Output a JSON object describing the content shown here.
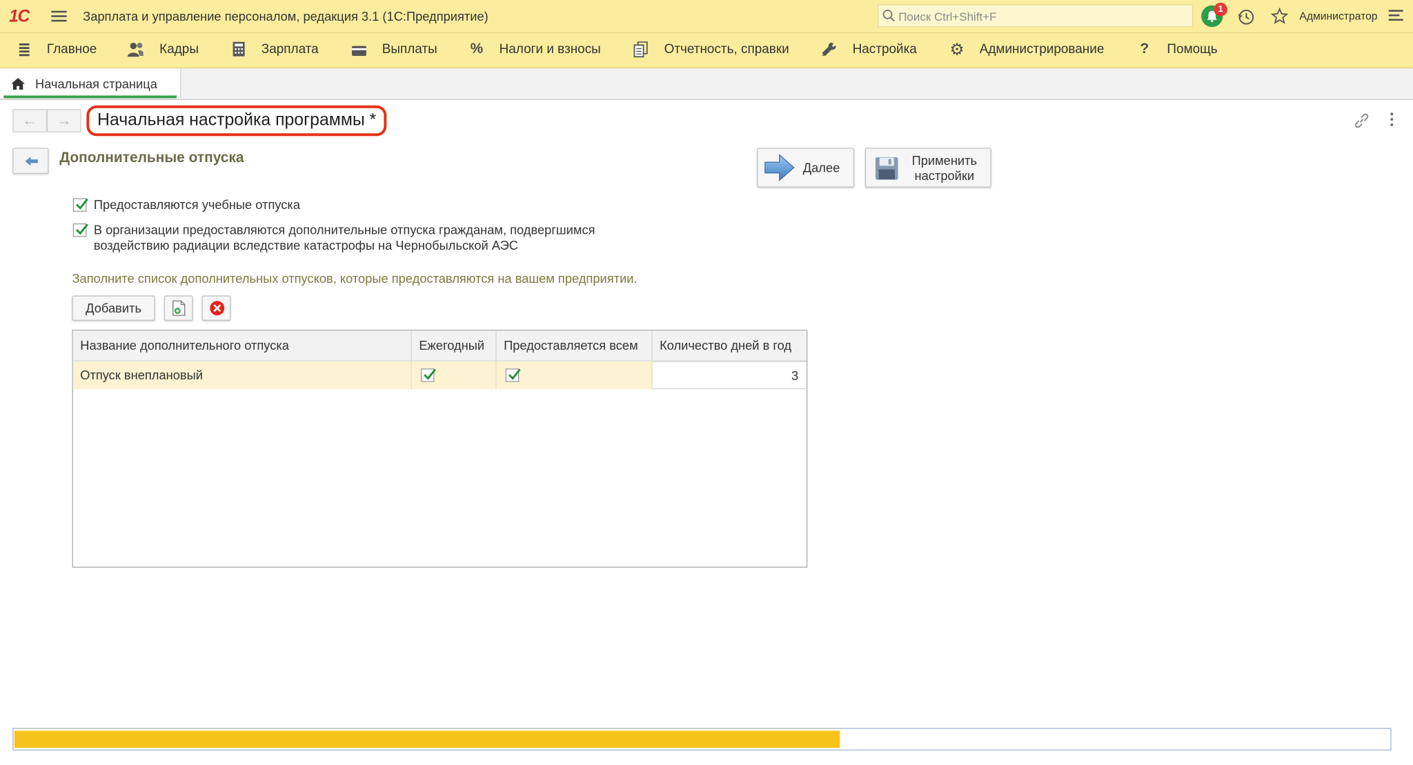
{
  "app": {
    "logo": "1С",
    "title": "Зарплата и управление персоналом, редакция 3.1  (1С:Предприятие)",
    "search_placeholder": "Поиск Ctrl+Shift+F",
    "notifications_count": "1",
    "user": "Администратор"
  },
  "sections": [
    {
      "label": "Главное",
      "icon": "menu-icon"
    },
    {
      "label": "Кадры",
      "icon": "people-icon"
    },
    {
      "label": "Зарплата",
      "icon": "calculator-icon"
    },
    {
      "label": "Выплаты",
      "icon": "wallet-icon"
    },
    {
      "label": "Налоги и взносы",
      "icon": "percent-icon"
    },
    {
      "label": "Отчетность, справки",
      "icon": "documents-icon"
    },
    {
      "label": "Настройка",
      "icon": "wrench-icon"
    },
    {
      "label": "Администрирование",
      "icon": "gear-icon"
    },
    {
      "label": "Помощь",
      "icon": "question-icon"
    }
  ],
  "tabs": {
    "home": "Начальная страница"
  },
  "form": {
    "title": "Начальная настройка программы *",
    "heading": "Дополнительные отпуска",
    "next_label": "Далее",
    "apply_label_line1": "Применить",
    "apply_label_line2": "настройки"
  },
  "options": {
    "study_leave": {
      "label": "Предоставляются учебные отпуска",
      "checked": true
    },
    "chernobyl_leave": {
      "line1": "В организации предоставляются дополнительные отпуска гражданам, подвергшимся",
      "line2": "воздействию радиации вследствие катастрофы на Чернобыльской АЭС",
      "checked": true
    }
  },
  "hint": "Заполните список дополнительных отпусков, которые предоставляются на вашем предприятии.",
  "table_toolbar": {
    "add_label": "Добавить"
  },
  "table": {
    "columns": [
      "Название дополнительного отпуска",
      "Ежегодный",
      "Предоставляется всем",
      "Количество дней в год"
    ],
    "rows": [
      {
        "name": "Отпуск внеплановый",
        "annual": true,
        "for_all": true,
        "days": "3"
      }
    ]
  },
  "progress": {
    "fraction": 0.6
  },
  "colors": {
    "brand_yellow": "#fbed9e",
    "accent_green": "#3aa14e",
    "highlight_red": "#e53118",
    "progress": "#f6c21c"
  }
}
